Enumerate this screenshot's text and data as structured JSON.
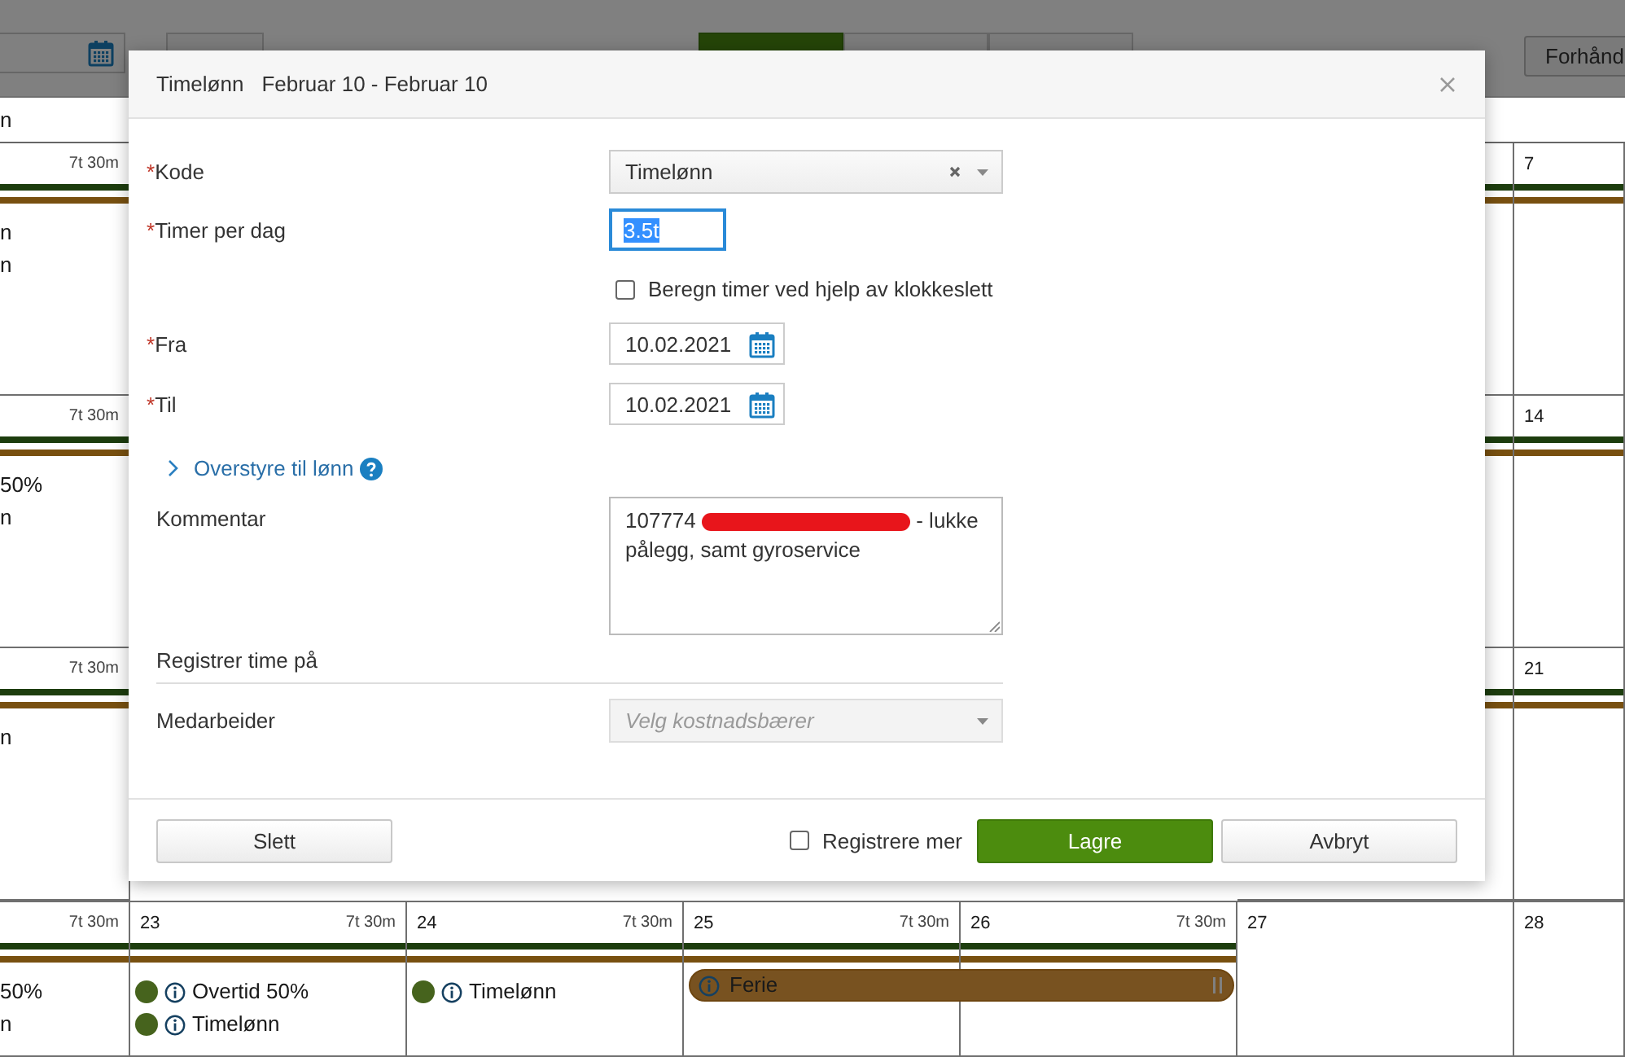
{
  "toolbar": {
    "view_buttons": [
      {
        "selected": true
      },
      {
        "selected": false
      },
      {
        "selected": false
      }
    ],
    "right_button": "Forhånd"
  },
  "calendar": {
    "header": "n",
    "weeks": [
      {
        "cells": [
          {
            "hours": "7t 30m",
            "stripes": true,
            "events": [
              {
                "kind": "text",
                "label": "n"
              },
              {
                "kind": "text",
                "label": "n"
              }
            ]
          },
          {
            "stripes": true
          },
          {
            "day": "7",
            "stripes": true
          }
        ]
      },
      {
        "cells": [
          {
            "hours": "7t 30m",
            "stripes": true,
            "events": [
              {
                "kind": "text",
                "label": "50%"
              },
              {
                "kind": "text",
                "label": "n"
              }
            ]
          },
          {
            "stripes": true
          },
          {
            "day": "14",
            "stripes": true
          }
        ]
      },
      {
        "cells": [
          {
            "hours": "7t 30m",
            "stripes": true,
            "events": [
              {
                "kind": "text",
                "label": "n"
              }
            ]
          },
          {
            "stripes": true
          },
          {
            "day": "21",
            "stripes": true
          }
        ]
      },
      {
        "cells": [
          {
            "hours": "7t 30m",
            "stripes": true,
            "events": [
              {
                "kind": "text",
                "label": "50%"
              },
              {
                "kind": "text",
                "label": "n"
              }
            ]
          },
          {
            "day": "23",
            "hours": "7t 30m",
            "stripes": true,
            "events": [
              {
                "kind": "entry",
                "label": "Overtid 50%"
              },
              {
                "kind": "entry",
                "label": "Timelønn"
              }
            ]
          },
          {
            "day": "24",
            "hours": "7t 30m",
            "stripes": true,
            "events": [
              {
                "kind": "entry",
                "label": "Timelønn"
              }
            ]
          },
          {
            "day": "25",
            "hours": "7t 30m",
            "stripes": true,
            "events": [
              {
                "kind": "bar",
                "label": "Ferie",
                "continues": true
              }
            ]
          },
          {
            "day": "26",
            "hours": "7t 30m",
            "stripes": true
          },
          {
            "day": "27",
            "stripes": false
          },
          {
            "day": "28",
            "stripes": false
          }
        ]
      }
    ]
  },
  "dialog": {
    "title": "Timelønn",
    "subtitle": "Februar 10 - Februar 10",
    "fields": [
      {
        "kind": "select",
        "mark": "*",
        "label": "Kode",
        "value": "Timelønn",
        "clearable": true
      },
      {
        "kind": "text",
        "mark": "*",
        "label": "Timer per dag",
        "value": "3.5t",
        "focused": true,
        "text_selected": true
      },
      {
        "kind": "checkbox",
        "label": "Beregn timer ved hjelp av klokkeslett",
        "checked": false
      },
      {
        "kind": "date",
        "mark": "*",
        "label": "Fra",
        "value": "10.02.2021"
      },
      {
        "kind": "date",
        "mark": "*",
        "label": "Til",
        "value": "10.02.2021"
      },
      {
        "kind": "expander",
        "label": "Overstyre til lønn",
        "expanded": false,
        "help": true
      },
      {
        "kind": "textarea",
        "label": "Kommentar",
        "value_start": "107774",
        "value_end": "- lukke pålegg, samt gyroservice",
        "redacted": true
      },
      {
        "kind": "section",
        "label": "Registrer time på"
      },
      {
        "kind": "select",
        "label": "Medarbeider",
        "placeholder": "Velg kostnadsbærer",
        "disabled": true
      }
    ],
    "footer": {
      "delete": "Slett",
      "register_more": {
        "label": "Registrere mer",
        "checked": false
      },
      "save": "Lagre",
      "cancel": "Avbryt"
    }
  }
}
